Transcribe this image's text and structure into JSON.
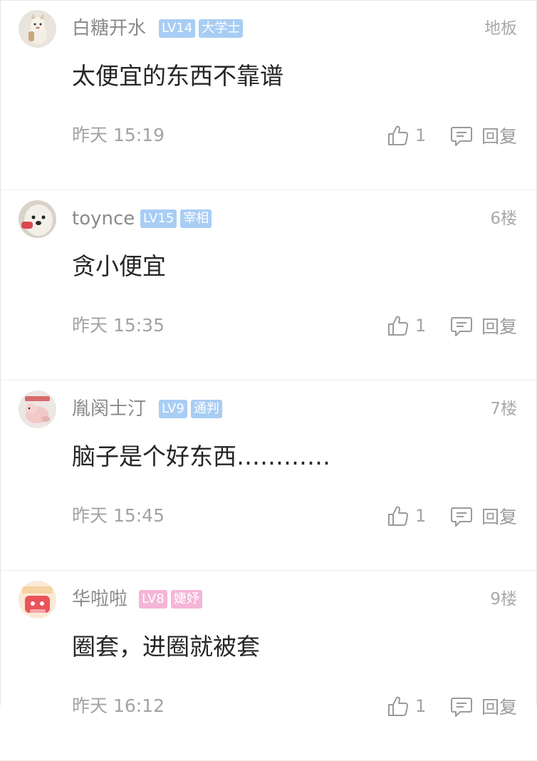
{
  "comments": [
    {
      "username": "白糖开水",
      "level": "LV14",
      "level_color": "#a8cdf4",
      "rank": "大学士",
      "rank_color": "#a8cdf4",
      "floor": "地板",
      "content": "太便宜的东西不靠谱",
      "time": "昨天 15:19",
      "likes": "1",
      "reply_label": "回复",
      "avatar_icon": "cat-figurine-avatar"
    },
    {
      "username": "toynce",
      "level": "LV15",
      "level_color": "#a8cdf4",
      "rank": "宰相",
      "rank_color": "#a8cdf4",
      "floor": "6楼",
      "content": "贪小便宜",
      "time": "昨天 15:35",
      "likes": "1",
      "reply_label": "回复",
      "avatar_icon": "dog-avatar"
    },
    {
      "username": "胤阕士汀",
      "level": "LV9",
      "level_color": "#a8cdf4",
      "rank": "通判",
      "rank_color": "#a8cdf4",
      "floor": "7楼",
      "content": "脑子是个好东西…………",
      "time": "昨天 15:45",
      "likes": "1",
      "reply_label": "回复",
      "avatar_icon": "pink-animal-avatar"
    },
    {
      "username": "华啦啦",
      "level": "LV8",
      "level_color": "#f5b5d8",
      "rank": "婕妤",
      "rank_color": "#f5b5d8",
      "floor": "9楼",
      "content": "圈套，进圈就被套",
      "time": "昨天 16:12",
      "likes": "1",
      "reply_label": "回复",
      "avatar_icon": "cartoon-avatar"
    }
  ]
}
